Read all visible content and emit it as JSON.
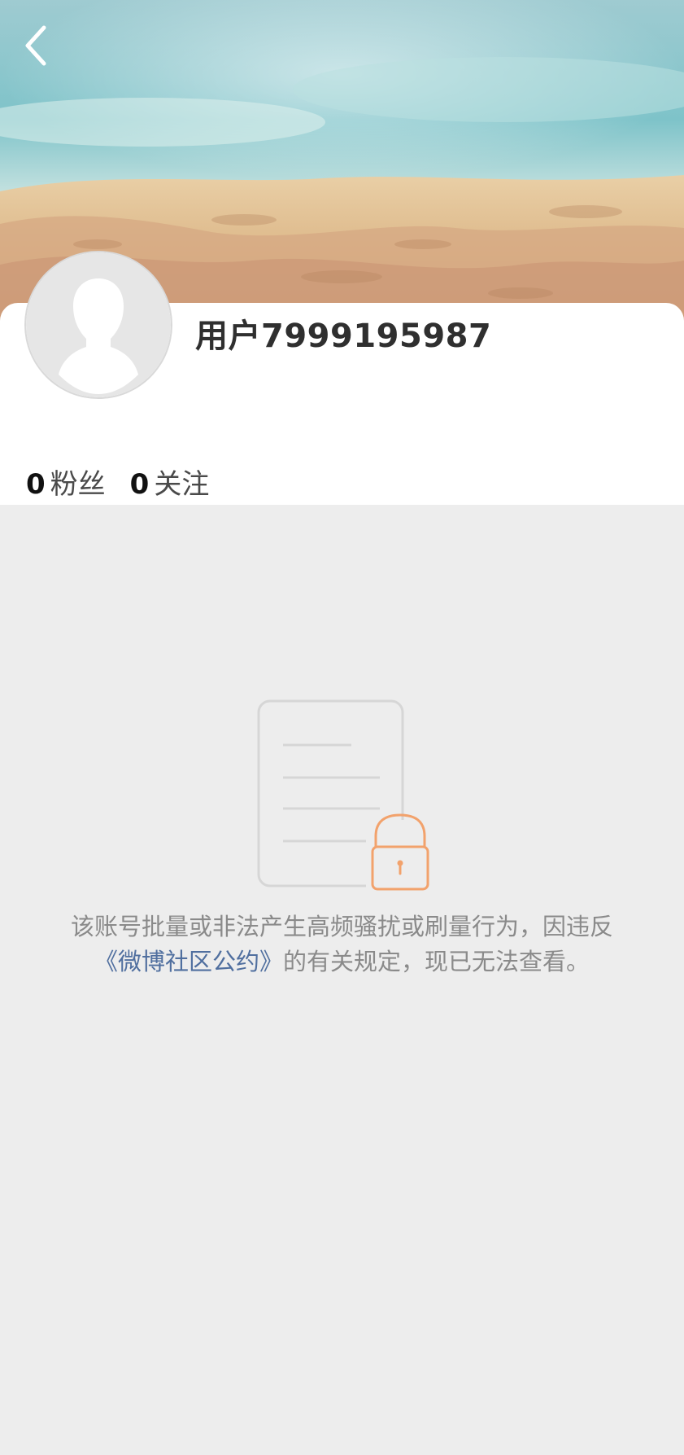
{
  "header": {
    "back_icon": "chevron-left-icon"
  },
  "profile": {
    "username": "用户7999195987",
    "avatar_icon": "default-person-avatar",
    "stats": [
      {
        "label": "粉丝",
        "value": "0"
      },
      {
        "label": "关注",
        "value": "0"
      }
    ]
  },
  "notice": {
    "icon": "document-lock-icon",
    "text_before": "该账号批量或非法产生高频骚扰或刷量行为，因违反",
    "link_text": "《微博社区公约》",
    "text_after": "的有关规定，现已无法查看。"
  },
  "colors": {
    "page_background": "#ededed",
    "card_background": "#ffffff",
    "username_text": "#2f2f2f",
    "notice_text": "#8a8a8a",
    "link_text": "#506f9f",
    "lock_accent": "#f2a26c"
  }
}
